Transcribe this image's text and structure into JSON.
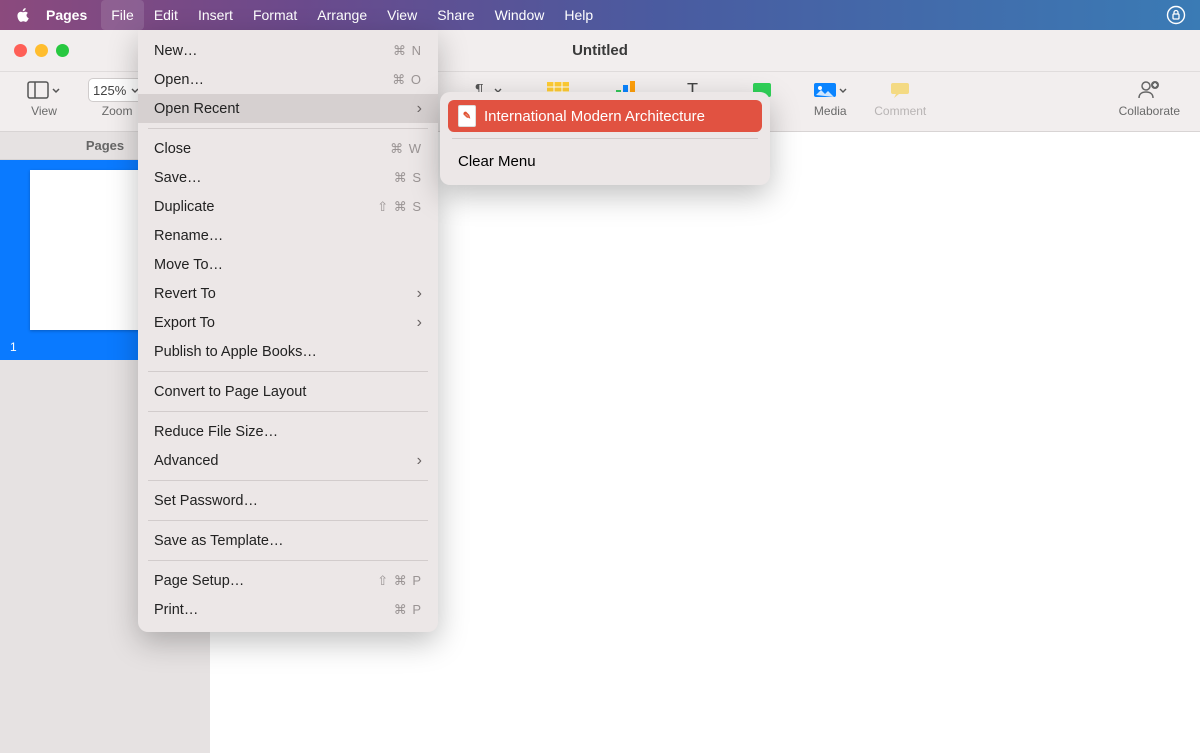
{
  "menubar": {
    "app": "Pages",
    "items": [
      "File",
      "Edit",
      "Insert",
      "Format",
      "Arrange",
      "View",
      "Share",
      "Window",
      "Help"
    ],
    "active": "File"
  },
  "window": {
    "title": "Untitled"
  },
  "toolbar": {
    "view": "View",
    "zoom_label": "Zoom",
    "zoom_value": "125%",
    "media": "Media",
    "comment": "Comment",
    "collaborate": "Collaborate"
  },
  "sidebar": {
    "header": "Pages",
    "page_number": "1"
  },
  "file_menu": {
    "items": [
      {
        "label": "New…",
        "shortcut": "⌘ N"
      },
      {
        "label": "Open…",
        "shortcut": "⌘ O"
      },
      {
        "label": "Open Recent",
        "submenu": true,
        "highlight": true
      },
      {
        "sep": true
      },
      {
        "label": "Close",
        "shortcut": "⌘ W"
      },
      {
        "label": "Save…",
        "shortcut": "⌘ S"
      },
      {
        "label": "Duplicate",
        "shortcut": "⇧ ⌘ S"
      },
      {
        "label": "Rename…"
      },
      {
        "label": "Move To…"
      },
      {
        "label": "Revert To",
        "submenu": true
      },
      {
        "label": "Export To",
        "submenu": true
      },
      {
        "label": "Publish to Apple Books…"
      },
      {
        "sep": true
      },
      {
        "label": "Convert to Page Layout"
      },
      {
        "sep": true
      },
      {
        "label": "Reduce File Size…"
      },
      {
        "label": "Advanced",
        "submenu": true
      },
      {
        "sep": true
      },
      {
        "label": "Set Password…"
      },
      {
        "sep": true
      },
      {
        "label": "Save as Template…"
      },
      {
        "sep": true
      },
      {
        "label": "Page Setup…",
        "shortcut": "⇧ ⌘ P"
      },
      {
        "label": "Print…",
        "shortcut": "⌘ P"
      }
    ]
  },
  "open_recent_submenu": {
    "recent": [
      {
        "label": "International Modern Architecture",
        "highlight": true
      }
    ],
    "clear": "Clear Menu"
  }
}
